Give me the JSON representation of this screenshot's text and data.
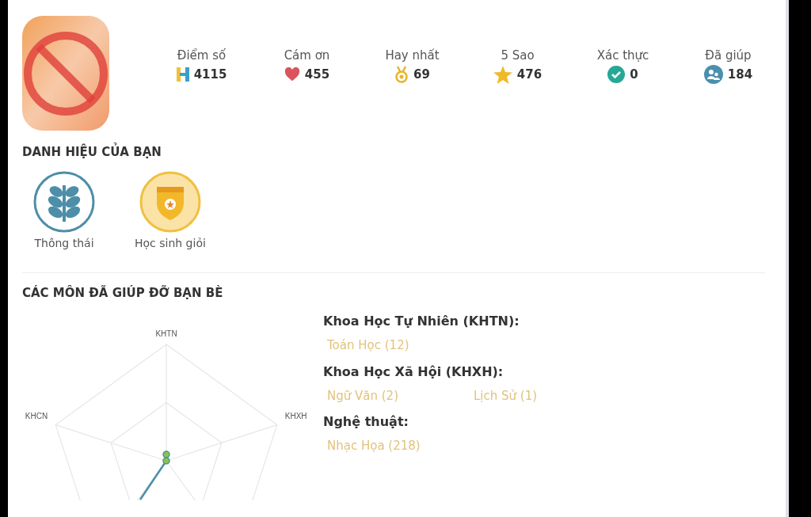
{
  "stats": [
    {
      "kind": "score",
      "label": "Điểm số",
      "value": "4115"
    },
    {
      "kind": "thanks",
      "label": "Cám ơn",
      "value": "455"
    },
    {
      "kind": "best",
      "label": "Hay nhất",
      "value": "69"
    },
    {
      "kind": "stars",
      "label": "5 Sao",
      "value": "476"
    },
    {
      "kind": "verified",
      "label": "Xác thực",
      "value": "0"
    },
    {
      "kind": "helped",
      "label": "Đã giúp",
      "value": "184"
    }
  ],
  "titles_section": {
    "heading": "DANH HIỆU CỦA BẠN",
    "badges": [
      {
        "kind": "wheat",
        "label": "Thông thái"
      },
      {
        "kind": "shield",
        "label": "Học sinh giỏi"
      }
    ]
  },
  "subjects_section": {
    "heading": "CÁC MÔN ĐÃ GIÚP ĐỠ BẠN BÈ",
    "radar_axes": [
      "KHTN",
      "KHXH",
      "KHCN"
    ],
    "groups": [
      {
        "name": "Khoa Học Tự Nhiên (KHTN):",
        "subjects": [
          "Toán Học (12)"
        ]
      },
      {
        "name": "Khoa Học Xã Hội (KHXH):",
        "subjects": [
          "Ngữ Văn (2)",
          "Lịch Sử (1)"
        ]
      },
      {
        "name": "Nghệ thuật:",
        "subjects": [
          "Nhạc Họa (218)"
        ]
      }
    ]
  }
}
